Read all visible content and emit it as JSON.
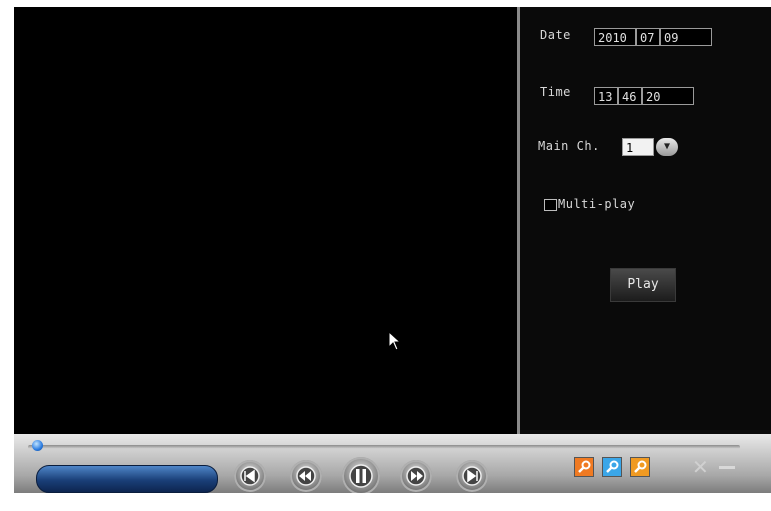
{
  "search_panel": {
    "date_label": "Date",
    "date": {
      "year": "2010",
      "month": "07",
      "day": "09"
    },
    "time_label": "Time",
    "time": {
      "hour": "13",
      "minute": "46",
      "second": "20"
    },
    "main_ch_label": "Main Ch.",
    "main_ch_value": "1",
    "multi_play_label": "Multi-play",
    "multi_play_checked": false,
    "play_button": "Play"
  },
  "playback": {
    "progress": 0.0,
    "icons": {
      "step_back": "skip-back-icon",
      "rewind": "rewind-icon",
      "pause": "pause-icon",
      "fast_forward": "fast-forward-icon",
      "step_forward": "skip-forward-icon",
      "zoom1": "zoom-icon",
      "zoom2": "zoom-icon",
      "zoom3": "zoom-icon",
      "close": "close-icon",
      "minimize": "minimize-icon"
    },
    "zoom_colors": [
      "#f07a22",
      "#3aa6e8",
      "#f09a22"
    ]
  }
}
